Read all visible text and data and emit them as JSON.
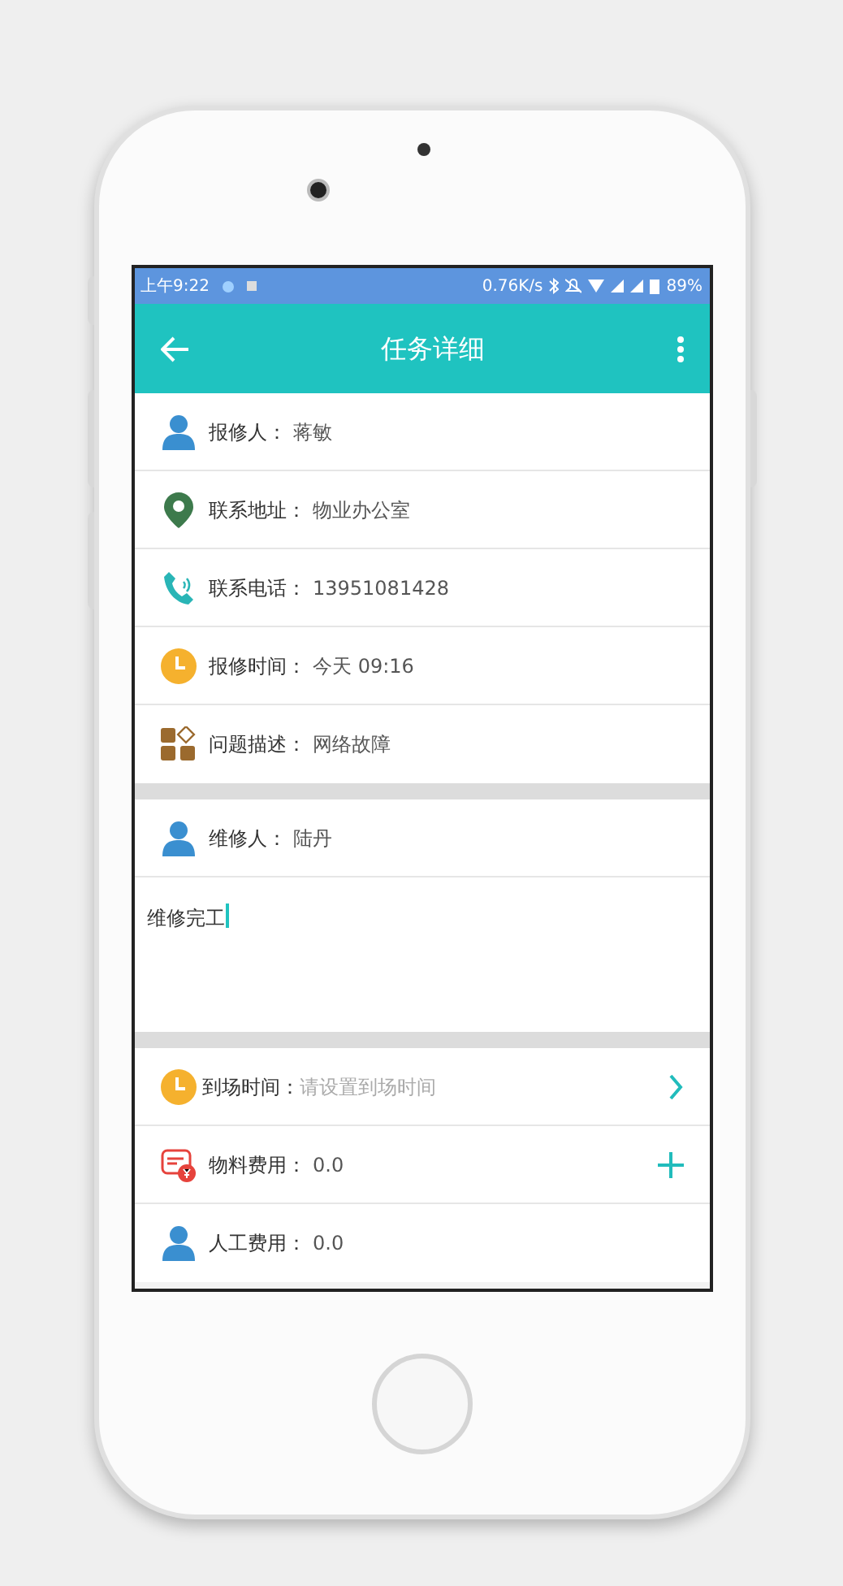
{
  "status_bar": {
    "time": "上午9:22",
    "network_speed": "0.76K/s",
    "battery": "89%"
  },
  "toolbar": {
    "title": "任务详细"
  },
  "info_rows": [
    {
      "kind": "person",
      "label": "报修人：",
      "value": "蒋敏"
    },
    {
      "kind": "location",
      "label": "联系地址：",
      "value": "物业办公室"
    },
    {
      "kind": "phone",
      "label": "联系电话：",
      "value": "13951081428"
    },
    {
      "kind": "clock",
      "label": "报修时间：",
      "value": "今天 09:16"
    },
    {
      "kind": "category",
      "label": "问题描述：",
      "value": "网络故障"
    }
  ],
  "repairer": {
    "kind": "person",
    "label": "维修人：",
    "value": "陆丹"
  },
  "note": {
    "value": "维修完工"
  },
  "cost_rows": [
    {
      "kind": "clock",
      "label": "到场时间：",
      "placeholder": "请设置到场时间",
      "chevron": true,
      "add_button": false
    },
    {
      "kind": "bill",
      "label": "物料费用：",
      "value": "0.0",
      "chevron": false,
      "add_button": true
    },
    {
      "kind": "person",
      "label": "人工费用：",
      "value": "0.0",
      "chevron": false,
      "add_button": false
    }
  ]
}
